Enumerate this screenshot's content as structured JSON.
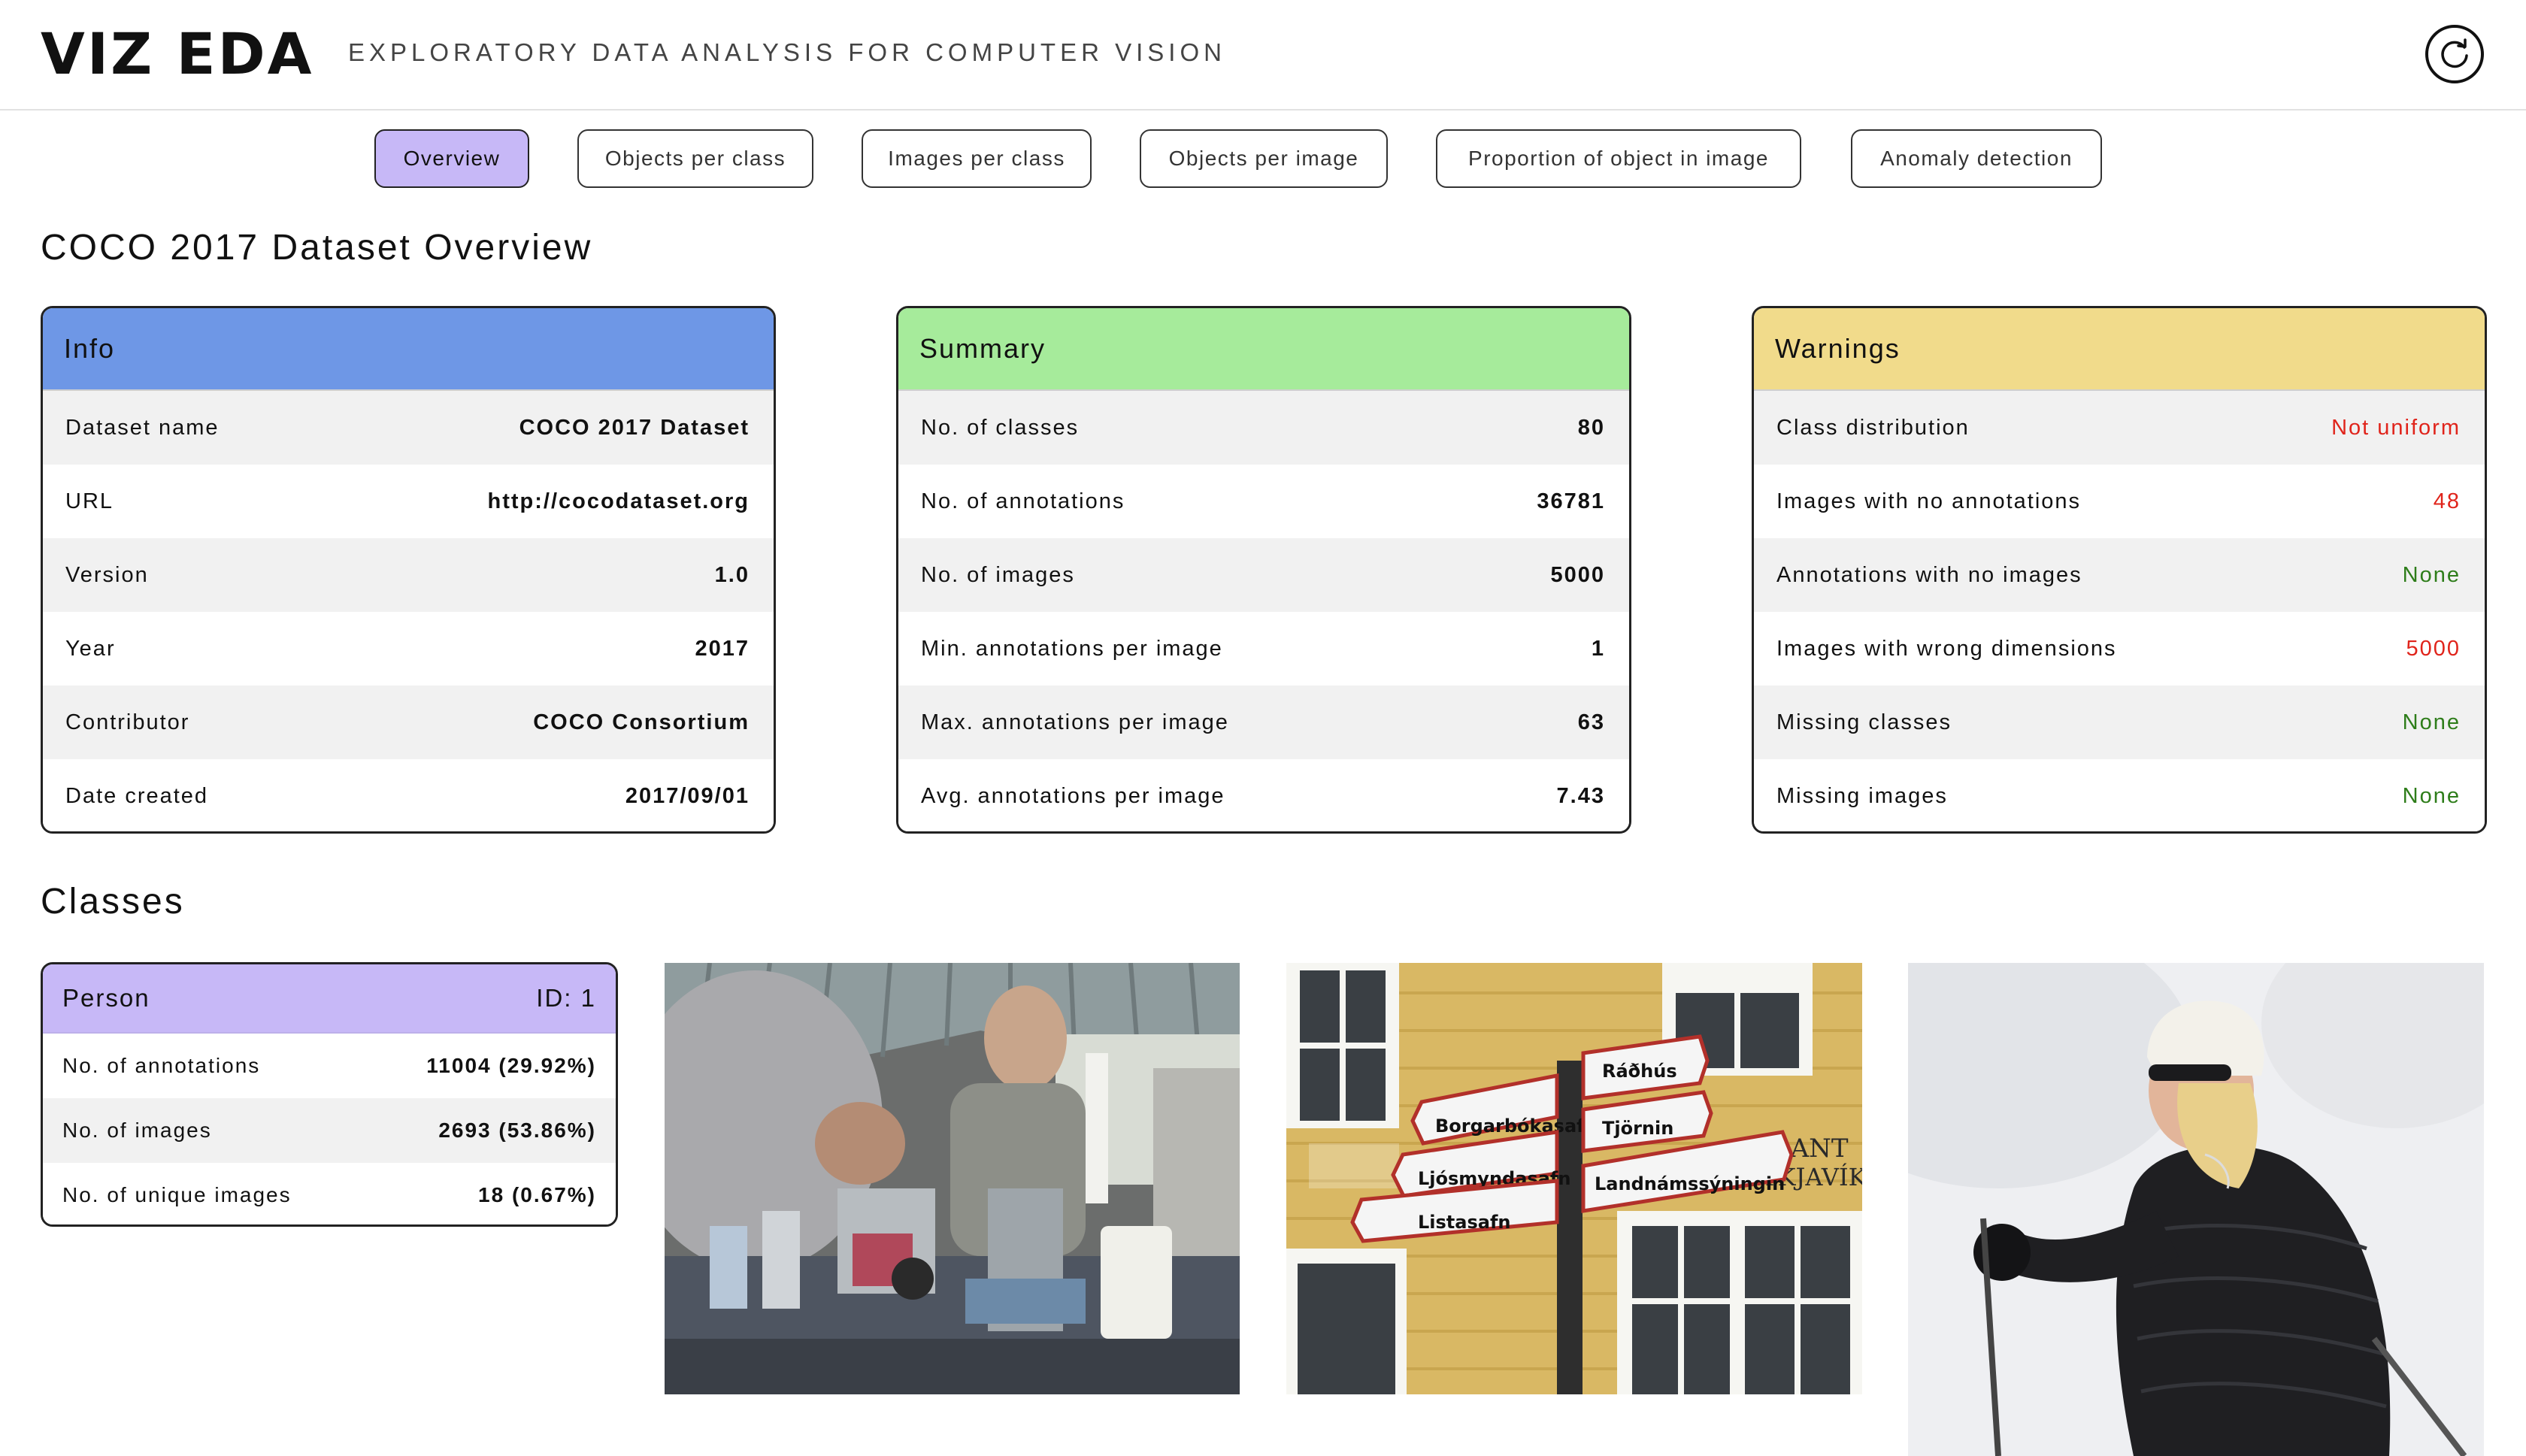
{
  "header": {
    "logo": "VIZ EDA",
    "subtitle": "EXPLORATORY DATA ANALYSIS FOR COMPUTER VISION",
    "refresh_icon": "refresh-icon"
  },
  "tabs": [
    {
      "label": "Overview",
      "active": true
    },
    {
      "label": "Objects per class",
      "active": false
    },
    {
      "label": "Images per class",
      "active": false
    },
    {
      "label": "Objects per image",
      "active": false
    },
    {
      "label": "Proportion of object in image",
      "active": false
    },
    {
      "label": "Anomaly detection",
      "active": false
    }
  ],
  "overview_title": "COCO 2017 Dataset Overview",
  "info": {
    "title": "Info",
    "color": "#6e97e6",
    "rows": [
      {
        "label": "Dataset name",
        "value": "COCO 2017 Dataset"
      },
      {
        "label": "URL",
        "value": "http://cocodataset.org"
      },
      {
        "label": "Version",
        "value": "1.0"
      },
      {
        "label": "Year",
        "value": "2017"
      },
      {
        "label": "Contributor",
        "value": "COCO Consortium"
      },
      {
        "label": "Date created",
        "value": "2017/09/01"
      }
    ]
  },
  "summary": {
    "title": "Summary",
    "color": "#a6eb9b",
    "rows": [
      {
        "label": "No. of classes",
        "value": "80"
      },
      {
        "label": "No. of annotations",
        "value": "36781"
      },
      {
        "label": "No. of images",
        "value": "5000"
      },
      {
        "label": "Min. annotations per image",
        "value": "1"
      },
      {
        "label": "Max. annotations per image",
        "value": "63"
      },
      {
        "label": "Avg. annotations per image",
        "value": "7.43"
      }
    ]
  },
  "warnings": {
    "title": "Warnings",
    "color": "#f1db8b",
    "rows": [
      {
        "label": "Class distribution",
        "value": "Not uniform",
        "color": "#e0241b"
      },
      {
        "label": "Images with no annotations",
        "value": "48",
        "color": "#e0241b"
      },
      {
        "label": "Annotations with no images",
        "value": "None",
        "color": "#2e7d1a"
      },
      {
        "label": "Images with wrong dimensions",
        "value": "5000",
        "color": "#e0241b"
      },
      {
        "label": "Missing classes",
        "value": "None",
        "color": "#2e7d1a"
      },
      {
        "label": "Missing images",
        "value": "None",
        "color": "#2e7d1a"
      }
    ]
  },
  "classes_title": "Classes",
  "class_card": {
    "name": "Person",
    "id_label": "ID: 1",
    "color": "#c7b8f7",
    "rows": [
      {
        "label": "No. of annotations",
        "value": "11004 (29.92%)"
      },
      {
        "label": "No. of images",
        "value": "2693 (53.86%)"
      },
      {
        "label": "No. of unique images",
        "value": "18 (0.67%)"
      }
    ]
  },
  "images": {
    "sign_texts": [
      "Ráðhús",
      "Borgarbókasafn",
      "Tjörnin",
      "Ljósmyndasafn",
      "Landnámssýningin",
      "Listasafn",
      "RANT",
      "REYKJAVÍK"
    ]
  }
}
